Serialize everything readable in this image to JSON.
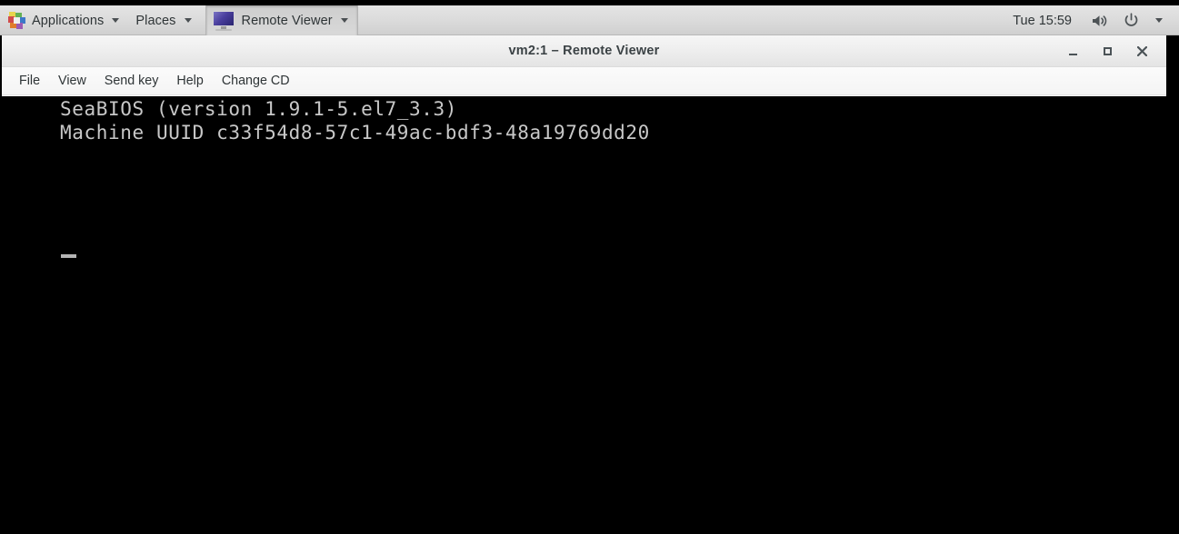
{
  "desktop": {
    "panel": {
      "applications": {
        "label": "Applications",
        "icon": "fedora-apps-icon"
      },
      "places": {
        "label": "Places",
        "icon": "chevron-down-icon"
      },
      "taskbar_window": {
        "label": "Remote Viewer",
        "icon": "monitor-icon"
      },
      "clock": "Tue 15:59",
      "volume_icon": "speaker-volume-icon",
      "power_icon": "power-icon",
      "system_menu_icon": "chevron-down-icon"
    }
  },
  "window": {
    "title": "vm2:1 – Remote Viewer",
    "controls": {
      "minimize": "–",
      "maximize": "□",
      "close": "×"
    },
    "menubar": [
      {
        "label": "File"
      },
      {
        "label": "View"
      },
      {
        "label": "Send key"
      },
      {
        "label": "Help"
      },
      {
        "label": "Change CD"
      }
    ]
  },
  "console": {
    "lines": "SeaBIOS (version 1.9.1-5.el7_3.3)\nMachine UUID c33f54d8-57c1-49ac-bdf3-48a19769dd20",
    "cursor": "_",
    "foreground": "#c8c8c8",
    "background": "#000000"
  },
  "colors": {
    "panel_bg": "#dcdcdc",
    "titlebar_bg": "#efefef",
    "text": "#2e3436",
    "console_fg": "#c8c8c8",
    "monitor_icon_screen": "#4a3f9e"
  }
}
